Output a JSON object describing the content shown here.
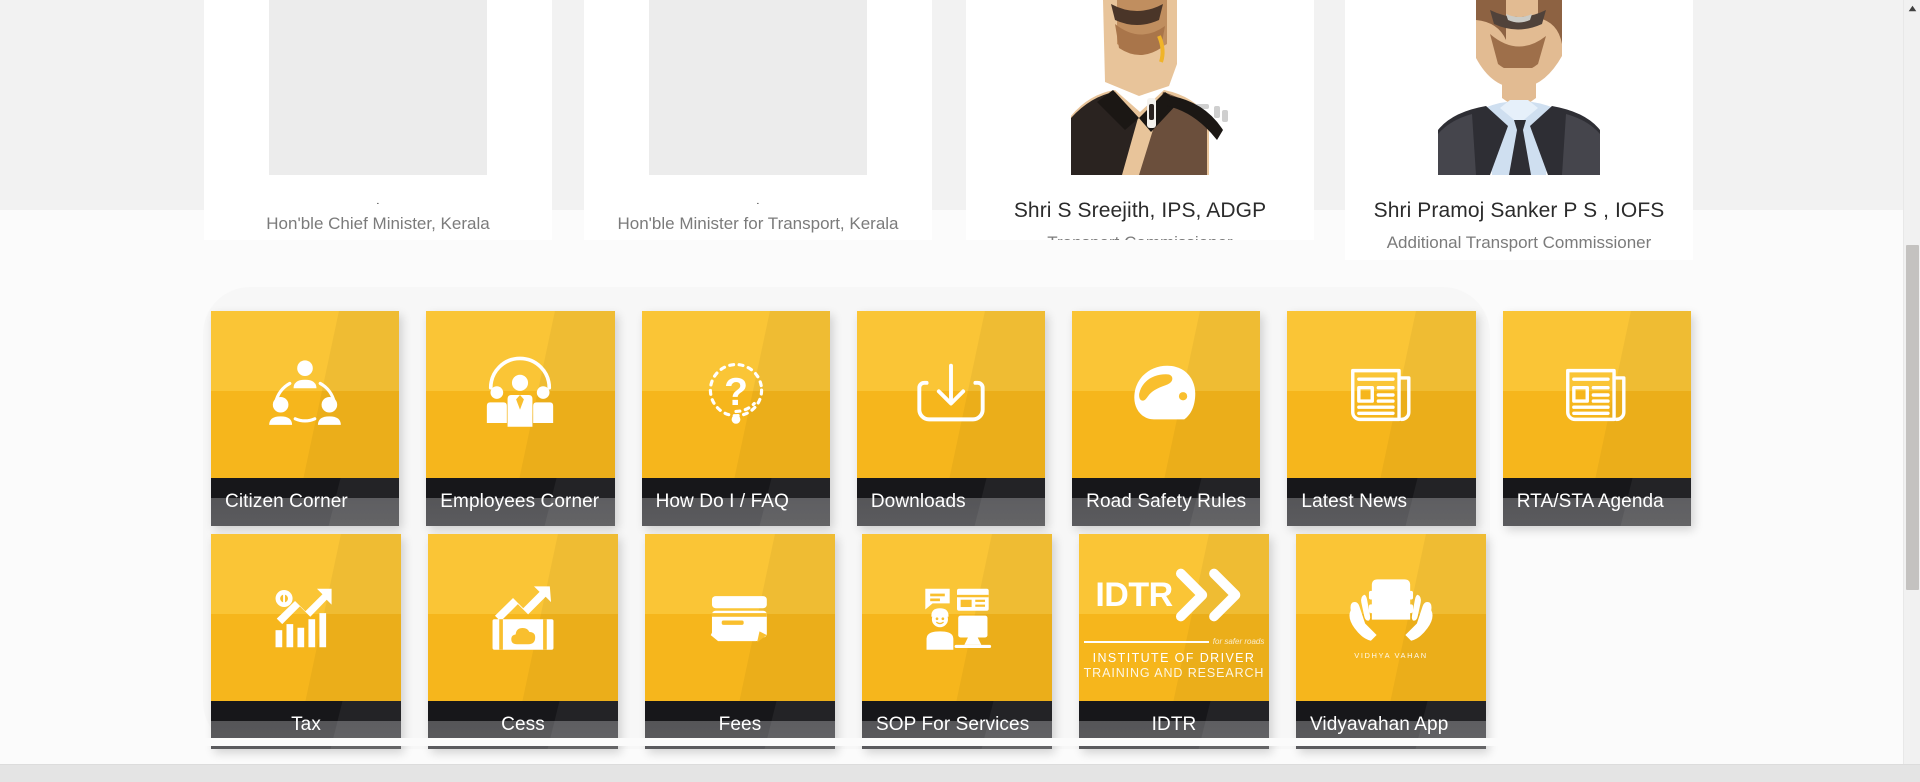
{
  "officials": [
    {
      "photo_placeholder": true,
      "name": ".",
      "role": "Hon'ble Chief Minister, Kerala"
    },
    {
      "photo_placeholder": true,
      "name": ".",
      "role": "Hon'ble Minister for Transport, Kerala"
    },
    {
      "photo_placeholder": false,
      "name": "Shri S Sreejith, IPS, ADGP",
      "role": "Transport Commissioner"
    },
    {
      "photo_placeholder": false,
      "name": "Shri Pramoj Sanker P S , IOFS",
      "role": "Additional Transport Commissioner"
    }
  ],
  "tiles": {
    "row1": [
      {
        "label": "Citizen Corner",
        "icon": "citizen-network-icon"
      },
      {
        "label": "Employees Corner",
        "icon": "employees-group-icon"
      },
      {
        "label": "How Do I / FAQ",
        "icon": "question-mark-icon"
      },
      {
        "label": "Downloads",
        "icon": "download-tray-icon"
      },
      {
        "label": "Road Safety Rules",
        "icon": "helmet-icon"
      },
      {
        "label": "Latest News",
        "icon": "newspaper-icon"
      },
      {
        "label": "RTA/STA Agenda",
        "icon": "newspaper-icon"
      }
    ],
    "row2": [
      {
        "label": "Tax",
        "icon": "growth-chart-coin-icon"
      },
      {
        "label": "Cess",
        "icon": "banknote-cloud-icon"
      },
      {
        "label": "Fees",
        "icon": "credit-card-icon"
      },
      {
        "label": "SOP For Services",
        "icon": "support-agent-icon"
      },
      {
        "label": "IDTR",
        "icon": "idtr-logo"
      },
      {
        "label": "Vidyavahan App",
        "icon": "vidyavahan-logo"
      }
    ]
  },
  "idtr_logo": {
    "word": "IDTR",
    "tagline": "for safer roads",
    "line1": "INSTITUTE OF DRIVER",
    "line2": "TRAINING AND RESEARCH"
  },
  "vidyavahan_logo": {
    "word": "VIDHYA VAHAN"
  },
  "colors": {
    "tile_top": "#fac536",
    "tile_bottom": "#f6b61c",
    "label_dark": "#17171a",
    "label_grey": "#57575a",
    "page_bg": "#f2f2f2",
    "panel_bg": "#f7f7f7",
    "scrollbar_thumb": "#c4c2c0"
  },
  "scrollbar": {
    "up_arrow": "scroll-up-arrow-icon"
  }
}
